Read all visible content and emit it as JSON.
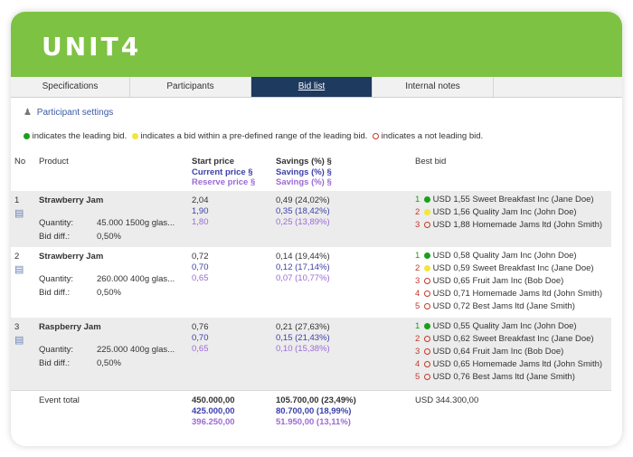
{
  "brand": {
    "logo": "UNIT4"
  },
  "tabs": [
    {
      "label": "Specifications",
      "active": false
    },
    {
      "label": "Participants",
      "active": false
    },
    {
      "label": "Bid list",
      "active": true
    },
    {
      "label": "Internal notes",
      "active": false
    }
  ],
  "participant_settings": "Participant settings",
  "legend": {
    "leading": "indicates the leading bid.",
    "within": "indicates a bid within a pre-defined range of the leading bid.",
    "not_leading": "indicates a not leading bid."
  },
  "columns": {
    "no": "No",
    "product": "Product",
    "start_price": "Start price",
    "current_price": "Current price §",
    "reserve_price": "Reserve price §",
    "savings1": "Savings (%) §",
    "savings2": "Savings (%) §",
    "savings3": "Savings (%) §",
    "best_bid": "Best bid"
  },
  "rows": [
    {
      "no": "1",
      "product": "Strawberry Jam",
      "qty_label": "Quantity:",
      "qty": "45.000 1500g glas...",
      "diff_label": "Bid diff.:",
      "diff": "0,50%",
      "start": "2,04",
      "current": "1,90",
      "reserve": "1,80",
      "sav1": "0,49 (24,02%)",
      "sav2": "0,35 (18,42%)",
      "sav3": "0,25 (13,89%)",
      "bids": [
        {
          "rank": "1",
          "status": "leading",
          "text": "USD 1,55 Sweet Breakfast Inc (Jane Doe)"
        },
        {
          "rank": "2",
          "status": "within",
          "text": "USD 1,56 Quality Jam Inc (John Doe)"
        },
        {
          "rank": "3",
          "status": "not",
          "text": "USD 1,88 Homemade Jams ltd (John Smith)"
        }
      ]
    },
    {
      "no": "2",
      "product": "Strawberry Jam",
      "qty_label": "Quantity:",
      "qty": "260.000 400g glas...",
      "diff_label": "Bid diff.:",
      "diff": "0,50%",
      "start": "0,72",
      "current": "0,70",
      "reserve": "0,65",
      "sav1": "0,14 (19,44%)",
      "sav2": "0,12 (17,14%)",
      "sav3": "0,07 (10,77%)",
      "bids": [
        {
          "rank": "1",
          "status": "leading",
          "text": "USD 0,58 Quality Jam Inc (John Doe)"
        },
        {
          "rank": "2",
          "status": "within",
          "text": "USD 0,59 Sweet Breakfast Inc (Jane Doe)"
        },
        {
          "rank": "3",
          "status": "not",
          "text": "USD 0,65 Fruit Jam Inc (Bob Doe)"
        },
        {
          "rank": "4",
          "status": "not",
          "text": "USD 0,71 Homemade Jams ltd (John Smith)"
        },
        {
          "rank": "5",
          "status": "not",
          "text": "USD 0,72 Best Jams ltd (Jane Smith)"
        }
      ]
    },
    {
      "no": "3",
      "product": "Raspberry Jam",
      "qty_label": "Quantity:",
      "qty": "225.000 400g glas...",
      "diff_label": "Bid diff.:",
      "diff": "0,50%",
      "start": "0,76",
      "current": "0,70",
      "reserve": "0,65",
      "sav1": "0,21 (27,63%)",
      "sav2": "0,15 (21,43%)",
      "sav3": "0,10 (15,38%)",
      "bids": [
        {
          "rank": "1",
          "status": "leading",
          "text": "USD 0,55 Quality Jam Inc (John Doe)"
        },
        {
          "rank": "2",
          "status": "not",
          "text": "USD 0,62 Sweet Breakfast Inc (Jane Doe)"
        },
        {
          "rank": "3",
          "status": "not",
          "text": "USD 0,64 Fruit Jam Inc (Bob Doe)"
        },
        {
          "rank": "4",
          "status": "not",
          "text": "USD 0,65 Homemade Jams ltd (John Smith)"
        },
        {
          "rank": "5",
          "status": "not",
          "text": "USD 0,76 Best Jams ltd (Jane Smith)"
        }
      ]
    }
  ],
  "total": {
    "label": "Event total",
    "start": "450.000,00",
    "current": "425.000,00",
    "reserve": "396.250,00",
    "sav1": "105.700,00 (23,49%)",
    "sav2": "80.700,00 (18,99%)",
    "sav3": "51.950,00 (13,11%)",
    "best": "USD 344.300,00"
  },
  "colors": {
    "brand": "#7dc242",
    "active_tab": "#1e3a5f",
    "leading": "#1aa01a",
    "within": "#f2e63a",
    "not_leading": "#c0392b"
  }
}
